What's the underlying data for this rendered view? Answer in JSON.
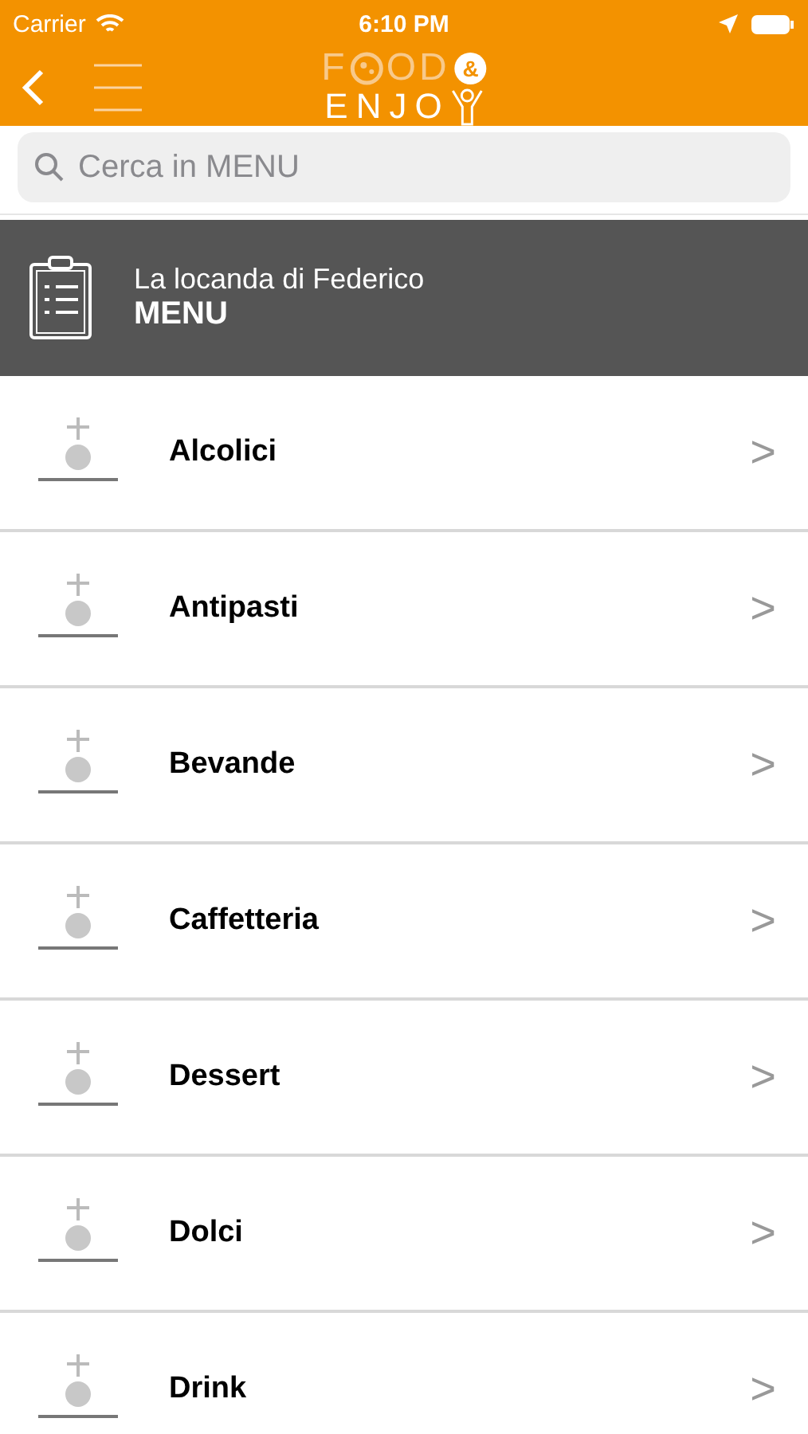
{
  "status_bar": {
    "carrier": "Carrier",
    "time": "6:10 PM"
  },
  "nav": {
    "logo": {
      "top_start": "F",
      "top_end": "OD",
      "ampersand": "&",
      "bottom": "ENJO"
    }
  },
  "search": {
    "placeholder": "Cerca in MENU"
  },
  "header": {
    "subtitle": "La locanda di Federico",
    "title": "MENU"
  },
  "categories": [
    {
      "label": "Alcolici",
      "chevron": ">"
    },
    {
      "label": "Antipasti",
      "chevron": ">"
    },
    {
      "label": "Bevande",
      "chevron": ">"
    },
    {
      "label": "Caffetteria",
      "chevron": ">"
    },
    {
      "label": "Dessert",
      "chevron": ">"
    },
    {
      "label": "Dolci",
      "chevron": ">"
    },
    {
      "label": "Drink",
      "chevron": ">"
    }
  ]
}
